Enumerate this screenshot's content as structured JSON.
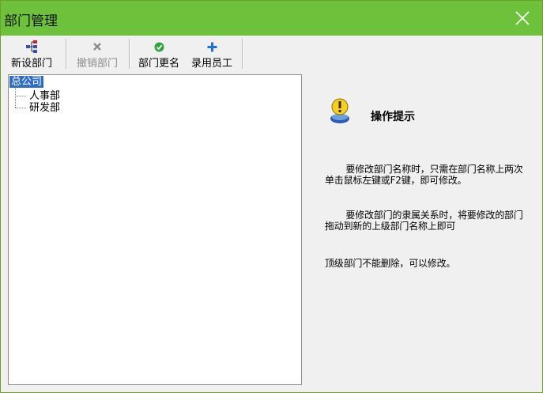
{
  "window": {
    "title": "部门管理"
  },
  "toolbar": {
    "buttons": [
      {
        "label": "新设部门",
        "icon": "add-department-icon",
        "enabled": true
      },
      {
        "label": "撤销部门",
        "icon": "delete-x-icon",
        "enabled": false
      },
      {
        "label": "部门更名",
        "icon": "check-icon",
        "enabled": true
      },
      {
        "label": "录用员工",
        "icon": "plus-icon",
        "enabled": true
      }
    ]
  },
  "tree": {
    "root": "总公司",
    "children": [
      "人事部",
      "研发部"
    ]
  },
  "hint": {
    "title": "操作提示",
    "paragraphs": [
      "要修改部门名称时，只需在部门名称上两次单击鼠标左键或F2键，即可修改。",
      "要修改部门的隶属关系时，将要修改的部门拖动到新的上级部门名称上即可",
      "顶级部门不能删除，可以修改。"
    ]
  },
  "colors": {
    "titlebar": "#6ec23b",
    "selection": "#2e6ec8",
    "disabled_text": "#8c8c8c"
  }
}
